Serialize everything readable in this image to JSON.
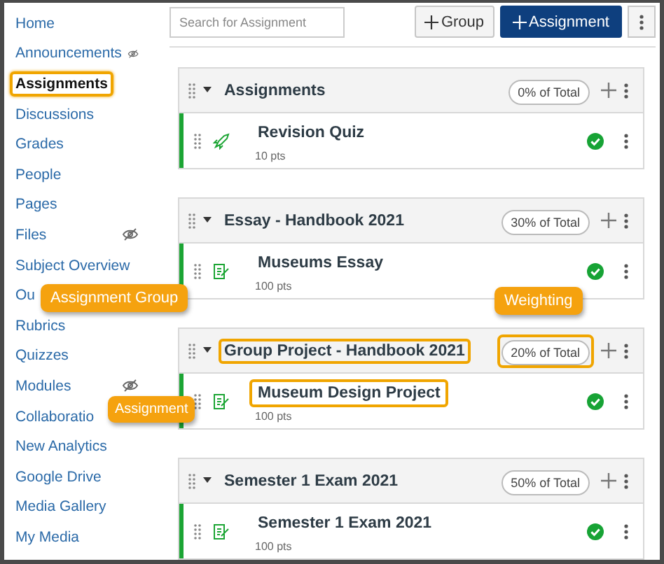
{
  "sidebar": {
    "items": [
      {
        "label": "Home",
        "selected": false,
        "hidden_from_students": false
      },
      {
        "label": "Announcements",
        "selected": false,
        "hidden_from_students": true
      },
      {
        "label": "Assignments",
        "selected": true,
        "hidden_from_students": false,
        "highlighted": true
      },
      {
        "label": "Discussions",
        "selected": false,
        "hidden_from_students": false
      },
      {
        "label": "Grades",
        "selected": false,
        "hidden_from_students": false
      },
      {
        "label": "People",
        "selected": false,
        "hidden_from_students": false
      },
      {
        "label": "Pages",
        "selected": false,
        "hidden_from_students": false
      },
      {
        "label": "Files",
        "selected": false,
        "hidden_from_students": true
      },
      {
        "label": "Subject Overview",
        "selected": false,
        "hidden_from_students": false
      },
      {
        "label": "Ou",
        "selected": false,
        "hidden_from_students": false
      },
      {
        "label": "Rubrics",
        "selected": false,
        "hidden_from_students": false
      },
      {
        "label": "Quizzes",
        "selected": false,
        "hidden_from_students": false
      },
      {
        "label": "Modules",
        "selected": false,
        "hidden_from_students": true
      },
      {
        "label": "Collaboratio",
        "selected": false,
        "hidden_from_students": false
      },
      {
        "label": "New Analytics",
        "selected": false,
        "hidden_from_students": false
      },
      {
        "label": "Google Drive",
        "selected": false,
        "hidden_from_students": false
      },
      {
        "label": "Media Gallery",
        "selected": false,
        "hidden_from_students": false
      },
      {
        "label": "My Media",
        "selected": false,
        "hidden_from_students": false
      }
    ]
  },
  "toolbar": {
    "search": {
      "placeholder": "Search for Assignment"
    },
    "buttons": [
      {
        "label": "Group",
        "kind": "secondary"
      },
      {
        "label": "Assignment",
        "kind": "primary"
      }
    ]
  },
  "groups": [
    {
      "title": "Assignments",
      "weight": "0% of Total",
      "highlight_title": false,
      "highlight_weight": false,
      "items": [
        {
          "title": "Revision Quiz",
          "points": "10 pts",
          "kind": "quiz",
          "published": true,
          "highlighted": false
        }
      ]
    },
    {
      "title": "Essay - Handbook 2021",
      "weight": "30% of Total",
      "highlight_title": false,
      "highlight_weight": false,
      "items": [
        {
          "title": "Museums Essay",
          "points": "100 pts",
          "kind": "assignment",
          "published": true,
          "highlighted": false
        }
      ]
    },
    {
      "title": "Group Project - Handbook 2021",
      "weight": "20% of Total",
      "highlight_title": true,
      "highlight_weight": true,
      "items": [
        {
          "title": "Museum Design Project",
          "points": "100 pts",
          "kind": "assignment",
          "published": true,
          "highlighted": true
        }
      ]
    },
    {
      "title": "Semester 1 Exam 2021",
      "weight": "50% of Total",
      "highlight_title": false,
      "highlight_weight": false,
      "items": [
        {
          "title": "Semester 1 Exam 2021",
          "points": "100 pts",
          "kind": "assignment",
          "published": true,
          "highlighted": false
        }
      ]
    }
  ],
  "callouts": [
    {
      "text": "Assignment Group"
    },
    {
      "text": "Weighting"
    },
    {
      "text": "Assignment"
    }
  ]
}
